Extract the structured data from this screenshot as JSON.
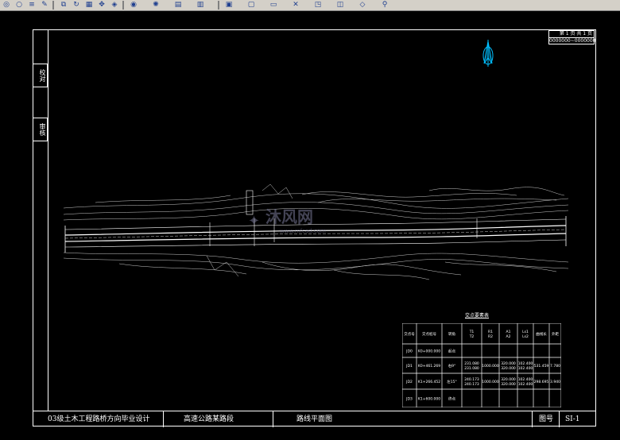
{
  "toolbar": {
    "icons": [
      "zoom-icon",
      "circle-icon",
      "layers-icon",
      "pen-icon",
      "copy-icon",
      "rotate-icon",
      "grid-icon",
      "pan-icon",
      "cube-icon",
      "sphere-icon",
      "light-icon",
      "props-icon",
      "layers2-icon",
      "save-icon",
      "print-icon",
      "open-icon",
      "close-icon",
      "view-icon",
      "layout-icon",
      "measure-icon",
      "search-icon"
    ]
  },
  "sidebar": {
    "box1": "校对",
    "box2": "审核"
  },
  "page_box": {
    "line1": "第 1 页  共 1 页",
    "line2": "0000000~0000000"
  },
  "title_block": {
    "project": "03级土木工程路桥方向毕业设计",
    "road": "高速公路某路段",
    "drawing": "路线平面图",
    "figno_label": "图号",
    "figno": "SI-1"
  },
  "watermark": {
    "main": "沐风网",
    "sub": "www.mfcad.com"
  },
  "table": {
    "title": "交点要素表",
    "headers": [
      "交点号",
      "交点桩号",
      "转角",
      "T1\nT2",
      "R1\nR2",
      "A1\nA2",
      "Ls1\nLs2",
      "曲线长",
      "外距"
    ],
    "rows": [
      [
        "JD0",
        "K0+000.000",
        "起点",
        "",
        "",
        "",
        "",
        "",
        ""
      ],
      [
        "JD1",
        "K0+461.269",
        "右9°",
        "231.080\n231.080",
        "1000.000",
        "320.000\n320.000",
        "102.400\n102.400",
        "531.459",
        "7.780"
      ],
      [
        "JD2",
        "K1+266.452",
        "左15°",
        "240.173\n240.173",
        "1000.000",
        "320.000\n320.000",
        "102.400\n102.400",
        "298.695",
        "3.940"
      ],
      [
        "JD3",
        "K1+600.000",
        "终点",
        "",
        "",
        "",
        "",
        "",
        ""
      ]
    ]
  },
  "colors": {
    "background": "#000000",
    "lines": "#ffffff",
    "north_arrow": "#00bfff",
    "watermark": "#5a5a7a"
  }
}
